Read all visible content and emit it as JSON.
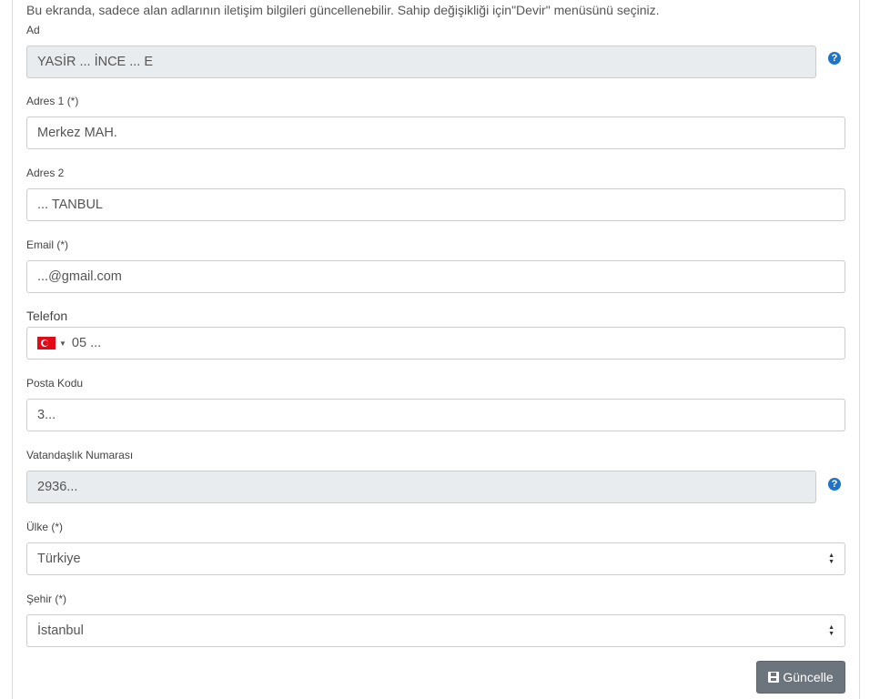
{
  "info_text": "Bu ekranda, sadece alan adlarının iletişim bilgileri güncellenebilir. Sahip değişikliği için\"Devir\" menüsünü seçiniz.",
  "fields": {
    "ad": {
      "label": "Ad",
      "value": "YASİR ... İNCE ... E"
    },
    "adres1": {
      "label": "Adres 1 (*)",
      "value": "Merkez MAH."
    },
    "adres2": {
      "label": "Adres 2",
      "value": "... TANBUL"
    },
    "email": {
      "label": "Email (*)",
      "value": "...@gmail.com"
    },
    "telefon": {
      "label": "Telefon",
      "value": "05 ..."
    },
    "posta_kodu": {
      "label": "Posta Kodu",
      "value": "3..."
    },
    "vatandaslik": {
      "label": "Vatandaşlık Numarası",
      "value": "2936..."
    },
    "ulke": {
      "label": "Ülke (*)",
      "value": "Türkiye"
    },
    "sehir": {
      "label": "Şehir (*)",
      "value": "İstanbul"
    }
  },
  "help_icon": "question-circle-icon",
  "country_flag": "turkey-flag-icon",
  "submit": {
    "label": "Güncelle",
    "icon": "save-icon",
    "color": "#6c757d"
  },
  "colors": {
    "readonly_bg": "#e9ecef",
    "help_blue": "#1f73c8"
  }
}
